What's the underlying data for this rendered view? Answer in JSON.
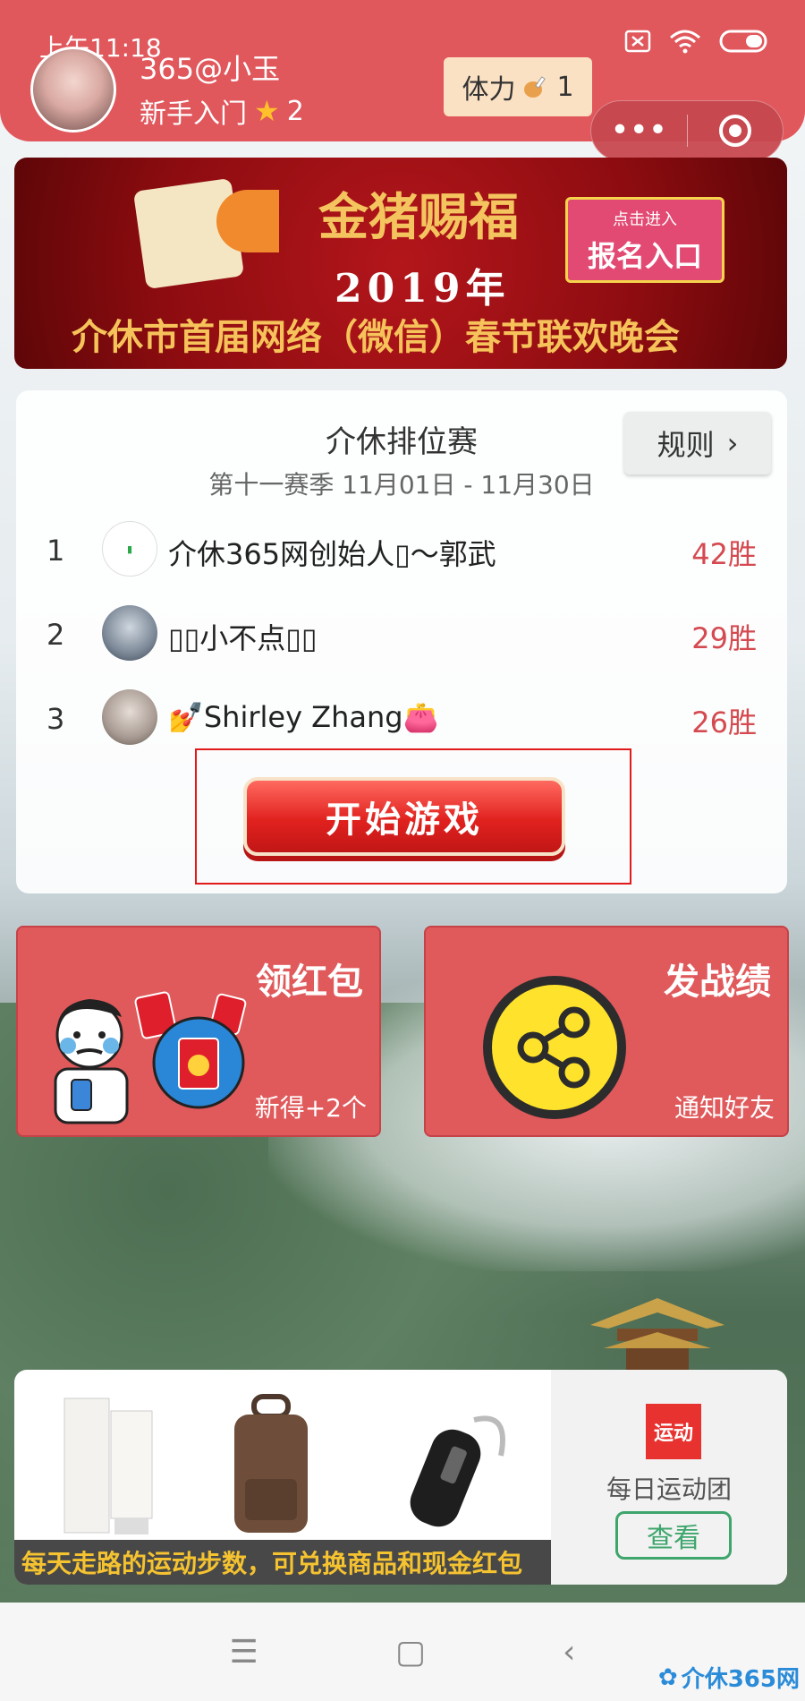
{
  "status_bar": {
    "time": "上午11:18"
  },
  "header": {
    "username": "365@小玉",
    "level": "新手入门",
    "level_stars": "2",
    "stamina_label": "体力",
    "stamina_value": "1",
    "accent_color": "#e0575c"
  },
  "capsule": {
    "more": "•••",
    "close": "close-circle-icon"
  },
  "banner": {
    "title": "金猪赐福",
    "year": "2019年",
    "subtitle": "介休市首届网络（微信）春节联欢晚会",
    "button_small": "点击进入",
    "button_label": "报名入口"
  },
  "ranking": {
    "title": "介休排位赛",
    "season": "第十一赛季 11月01日 - 11月30日",
    "rules_label": "规则",
    "rows": [
      {
        "rank": "1",
        "name": "介休365网创始人▯～郭武",
        "wins": "42胜"
      },
      {
        "rank": "2",
        "name": "▯▯小不点▯▯",
        "wins": "29胜"
      },
      {
        "rank": "3",
        "name": "💅Shirley Zhang👛",
        "wins": "26胜"
      }
    ],
    "start_label": "开始游戏"
  },
  "tiles": {
    "red_packet": {
      "title": "领红包",
      "sub": "新得+2个"
    },
    "share": {
      "title": "发战绩",
      "sub": "通知好友"
    }
  },
  "ad": {
    "caption": "每天走路的运动步数，可兑换商品和现金红包",
    "logo_text": "运动",
    "name": "每日运动团",
    "view_label": "查看"
  },
  "watermark": "介休365网"
}
